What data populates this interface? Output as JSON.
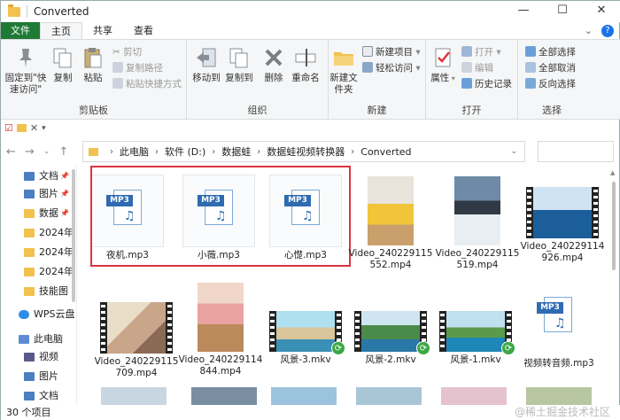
{
  "window": {
    "title": "Converted",
    "controls": [
      "minimize",
      "maximize",
      "close"
    ]
  },
  "tabs": [
    "文件",
    "主页",
    "共享",
    "查看"
  ],
  "ribbon": {
    "clipboard": {
      "label": "剪贴板",
      "pin": "固定到\"快速访问\"",
      "copy": "复制",
      "paste": "粘贴",
      "cut": "剪切",
      "copy_path": "复制路径",
      "paste_shortcut": "粘贴快捷方式"
    },
    "organize": {
      "label": "组织",
      "move_to": "移动到",
      "copy_to": "复制到",
      "delete": "删除",
      "rename": "重命名"
    },
    "new": {
      "label": "新建",
      "new_folder": "新建文件夹",
      "new_item": "新建项目",
      "easy_access": "轻松访问"
    },
    "open": {
      "label": "打开",
      "properties": "属性",
      "open": "打开",
      "edit": "编辑",
      "history": "历史记录"
    },
    "select": {
      "label": "选择",
      "select_all": "全部选择",
      "select_none": "全部取消",
      "invert": "反向选择"
    }
  },
  "breadcrumb": [
    "此电脑",
    "软件 (D:)",
    "数据蛙",
    "数据蛙视频转换器",
    "Converted"
  ],
  "nav": [
    {
      "label": "文档",
      "pinned": true,
      "color": "#4a7fc1"
    },
    {
      "label": "图片",
      "pinned": true,
      "color": "#4a7fc1"
    },
    {
      "label": "数据",
      "pinned": true,
      "color": "#f2c14e"
    },
    {
      "label": "2024年",
      "pinned": false,
      "color": "#f2c14e"
    },
    {
      "label": "2024年",
      "pinned": false,
      "color": "#f2c14e"
    },
    {
      "label": "2024年",
      "pinned": false,
      "color": "#f2c14e"
    },
    {
      "label": "技能图",
      "pinned": false,
      "color": "#f2c14e"
    },
    {
      "label": "WPS云盘",
      "pinned": false,
      "color": "#2b8de8"
    },
    {
      "label": "此电脑",
      "pinned": false,
      "color": "#5d8bd6"
    },
    {
      "label": "视频",
      "pinned": false,
      "color": "#5a5a8a"
    },
    {
      "label": "图片",
      "pinned": false,
      "color": "#4a7fc1"
    },
    {
      "label": "文档",
      "pinned": false,
      "color": "#4a7fc1"
    }
  ],
  "files": {
    "row1": [
      {
        "name": "夜机.mp3",
        "kind": "mp3"
      },
      {
        "name": "小薇.mp3",
        "kind": "mp3"
      },
      {
        "name": "心憷.mp3",
        "kind": "mp3"
      },
      {
        "name": "Video_240229115552.mp4",
        "kind": "portrait"
      },
      {
        "name": "Video_240229115519.mp4",
        "kind": "portrait"
      },
      {
        "name": "Video_240229114926.mp4",
        "kind": "film"
      }
    ],
    "row2": [
      {
        "name": "Video_240229115709.mp4",
        "kind": "film"
      },
      {
        "name": "Video_240229114844.mp4",
        "kind": "portrait"
      },
      {
        "name": "风景-3.mkv",
        "kind": "film"
      },
      {
        "name": "风景-2.mkv",
        "kind": "film"
      },
      {
        "name": "风景-1.mkv",
        "kind": "film"
      },
      {
        "name": "视频转音频.mp3",
        "kind": "mp3"
      }
    ],
    "mp3_tag": "MP3"
  },
  "status": {
    "count": "30 个项目"
  },
  "watermark": "@稀土掘金技术社区"
}
